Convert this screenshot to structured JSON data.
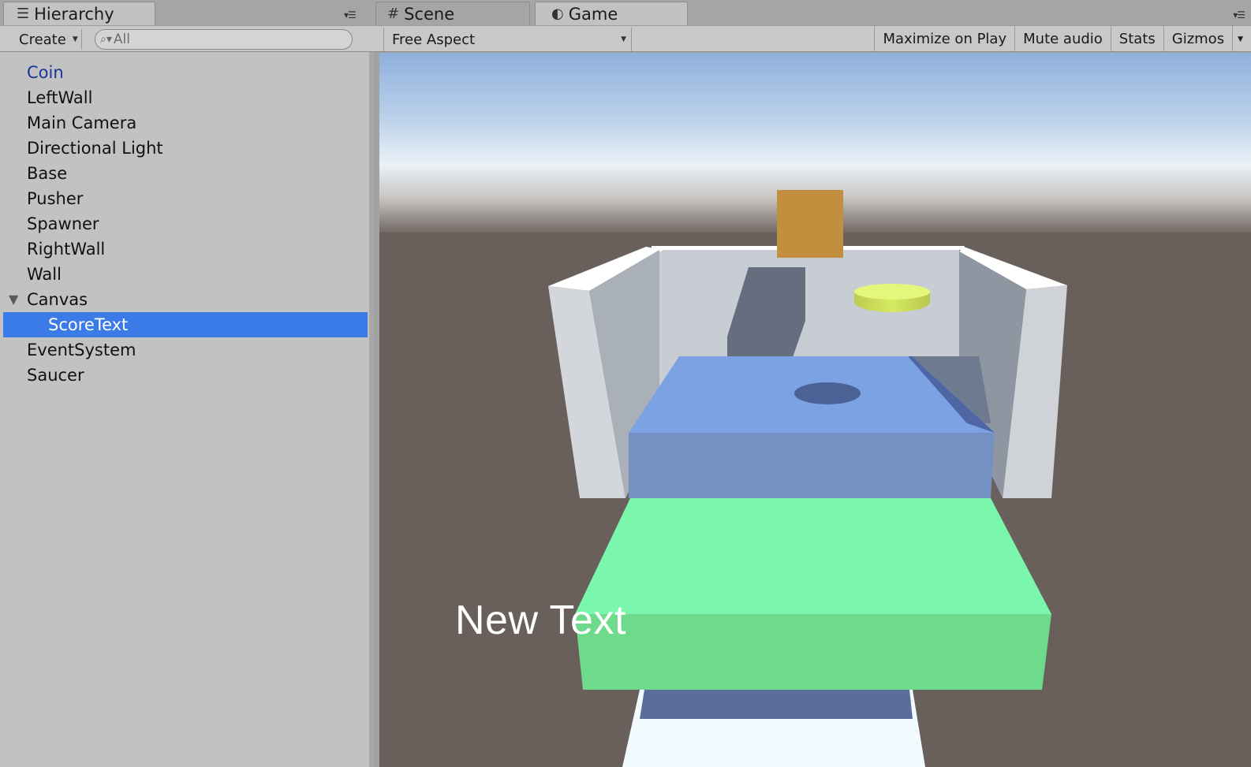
{
  "hierarchy": {
    "tab_label": "Hierarchy",
    "create_label": "Create",
    "search_placeholder": "All",
    "items": [
      {
        "label": "Coin"
      },
      {
        "label": "LeftWall"
      },
      {
        "label": "Main Camera"
      },
      {
        "label": "Directional Light"
      },
      {
        "label": "Base"
      },
      {
        "label": "Pusher"
      },
      {
        "label": "Spawner"
      },
      {
        "label": "RightWall"
      },
      {
        "label": "Wall"
      },
      {
        "label": "Canvas"
      },
      {
        "label": "ScoreText"
      },
      {
        "label": "EventSystem"
      },
      {
        "label": "Saucer"
      }
    ]
  },
  "game_view": {
    "tabs": [
      {
        "label": "Scene",
        "icon": "hash-icon"
      },
      {
        "label": "Game",
        "icon": "pacman-icon"
      }
    ],
    "aspect_label": "Free Aspect",
    "toolbar": {
      "maximize_label": "Maximize on Play",
      "mute_label": "Mute audio",
      "stats_label": "Stats",
      "gizmos_label": "Gizmos"
    },
    "score_text": "New Text"
  },
  "colors": {
    "selection": "#3b7be8",
    "prefab_link": "#16359b",
    "ground": "#6a605b",
    "pusher": "#7aa2e6",
    "base": "#79f7aa",
    "coin": "#d9ef6e",
    "falling_box": "#c28f3e"
  }
}
